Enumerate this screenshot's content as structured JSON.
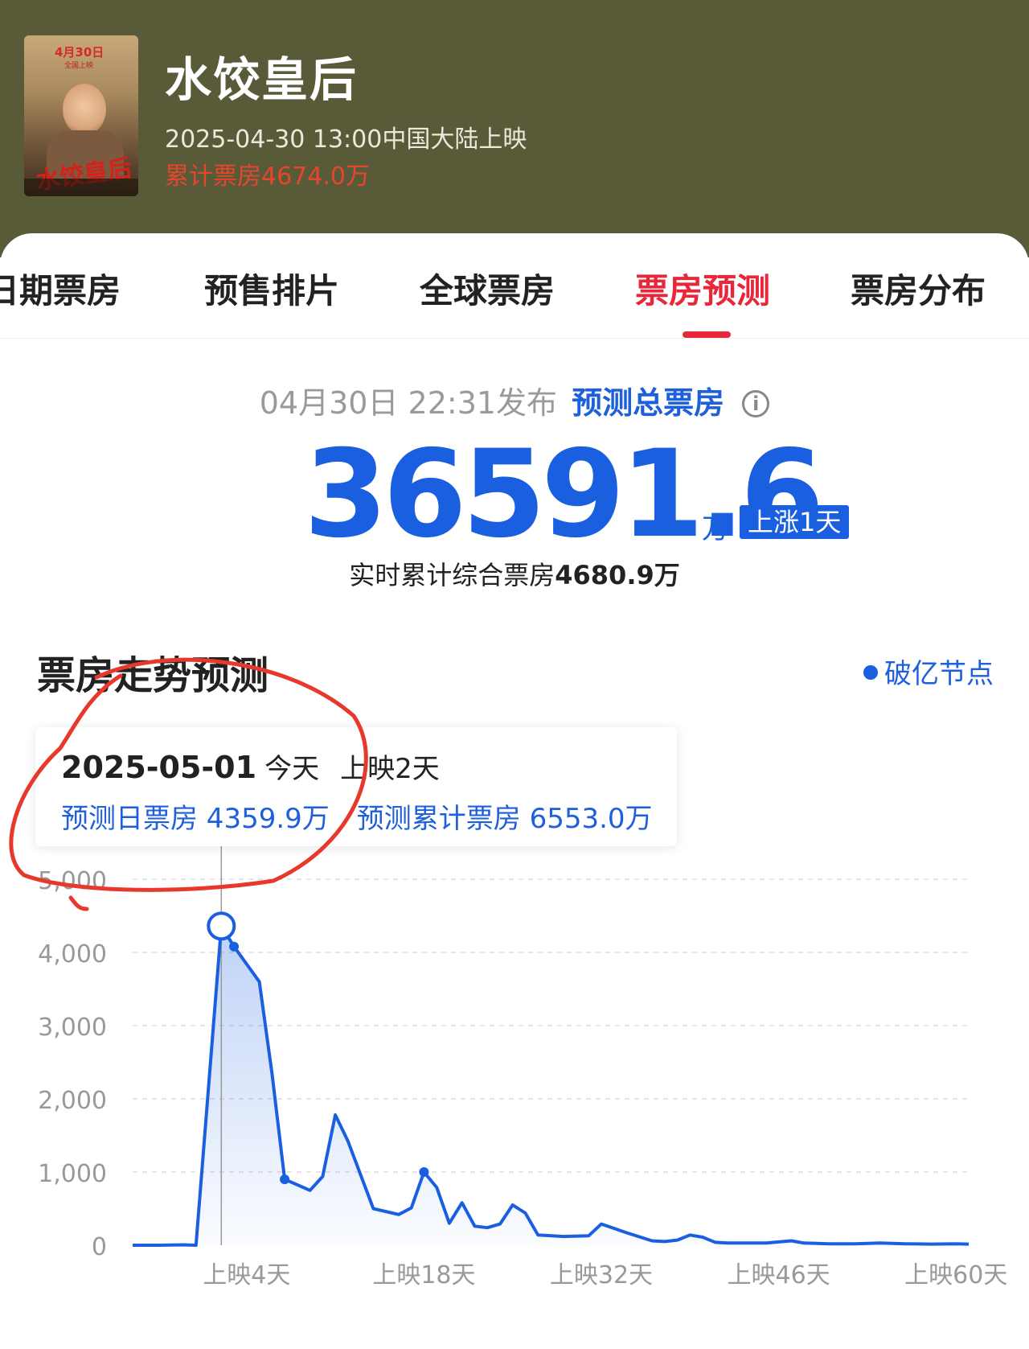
{
  "movie": {
    "title": "水饺皇后",
    "release": "2025-04-30 13:00中国大陆上映",
    "cumulative": "累计票房4674.0万",
    "poster": {
      "date_text": "4月30日",
      "sub_text": "全国上映",
      "title_text": "水饺皇后"
    }
  },
  "tabs": [
    {
      "label": "日期票房",
      "active": false
    },
    {
      "label": "预售排片",
      "active": false
    },
    {
      "label": "全球票房",
      "active": false
    },
    {
      "label": "票房预测",
      "active": true
    },
    {
      "label": "票房分布",
      "active": false
    }
  ],
  "forecast": {
    "publish_time": "04月30日 22:31发布",
    "label": "预测总票房",
    "info_icon": "info-icon",
    "total": "36591.6",
    "unit": "万",
    "badge": "上涨1天",
    "realtime_prefix": "实时累计综合票房",
    "realtime_value": "4680.9万"
  },
  "section": {
    "title": "票房走势预测",
    "legend_label": "破亿节点"
  },
  "tooltip": {
    "date": "2025-05-01",
    "today": "今天",
    "day": "上映2天",
    "daily": "预测日票房 4359.9万",
    "cumulative": "预测累计票房 6553.0万"
  },
  "colors": {
    "accent_red": "#e8283a",
    "line_blue": "#1a5fe0",
    "header_bg": "#595a38",
    "annotation_red": "#e6392b"
  },
  "chart_data": {
    "type": "area",
    "ylim": [
      0,
      5000
    ],
    "yticks": [
      "0",
      "1,000",
      "2,000",
      "3,000",
      "4,000",
      "5,000"
    ],
    "xtick_labels": [
      "上映4天",
      "上映18天",
      "上映32天",
      "上映46天",
      "上映60天"
    ],
    "xticks_at_day": [
      4,
      18,
      32,
      46,
      60
    ],
    "series": [
      {
        "x": [
          -5,
          -3,
          -1,
          0,
          2,
          3,
          5,
          6,
          7,
          9,
          10,
          11,
          12,
          14,
          16,
          17,
          18,
          19,
          20,
          21,
          22,
          23,
          24,
          25,
          26,
          27,
          29,
          31,
          32,
          34,
          36,
          37,
          38,
          39,
          40,
          41,
          42,
          43,
          45,
          47,
          48,
          50,
          52,
          54,
          56,
          58,
          60,
          61
        ],
        "values": [
          0,
          0,
          5,
          0,
          4359.9,
          4080,
          3600,
          2350,
          900,
          750,
          940,
          1780,
          1420,
          500,
          420,
          510,
          1000,
          790,
          300,
          580,
          260,
          240,
          290,
          550,
          440,
          140,
          120,
          130,
          290,
          170,
          60,
          50,
          70,
          140,
          110,
          40,
          30,
          30,
          30,
          60,
          30,
          20,
          20,
          30,
          20,
          15,
          20,
          15
        ]
      }
    ],
    "highlight_index": 4,
    "markers_at_day": [
      3,
      7,
      18
    ]
  }
}
